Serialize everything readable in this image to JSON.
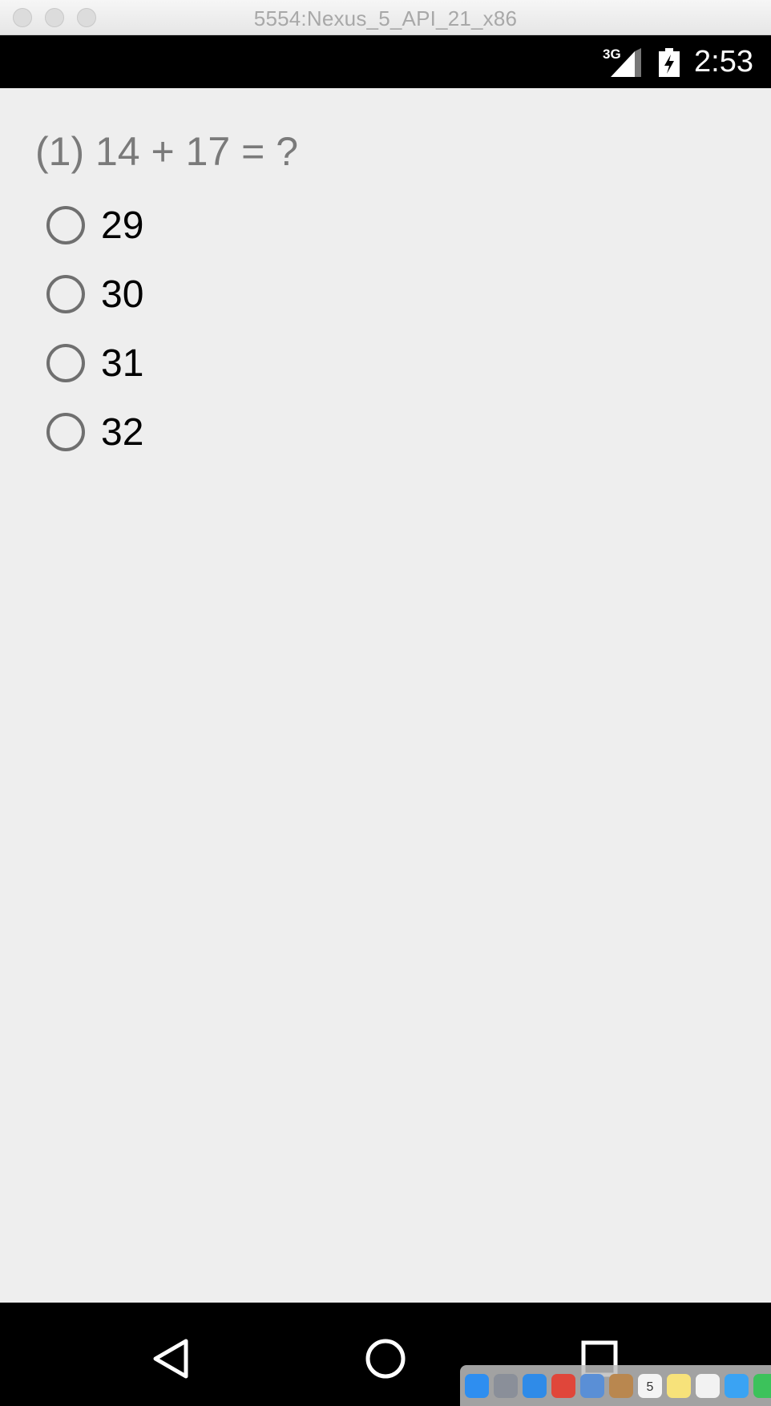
{
  "window": {
    "title": "5554:Nexus_5_API_21_x86"
  },
  "status_bar": {
    "network": "3G",
    "time": "2:53",
    "signal_icon": "cell-signal-icon",
    "battery_icon": "battery-charging-icon"
  },
  "quiz": {
    "question": "(1) 14 + 17 = ?",
    "options": [
      {
        "label": "29",
        "selected": false
      },
      {
        "label": "30",
        "selected": false
      },
      {
        "label": "31",
        "selected": false
      },
      {
        "label": "32",
        "selected": false
      }
    ]
  },
  "nav_bar": {
    "back_icon": "back-triangle-icon",
    "home_icon": "home-circle-icon",
    "recents_icon": "recents-square-icon"
  },
  "dock": {
    "calendar_day": "5",
    "icons": [
      "finder-icon",
      "launchpad-icon",
      "safari-icon",
      "chrome-icon",
      "preview-icon",
      "contacts-icon",
      "calendar-icon",
      "notes-icon",
      "textedit-icon",
      "messages-icon",
      "facetime-icon"
    ],
    "colors": [
      "#2e8ef0",
      "#8a8f99",
      "#2f8be8",
      "#e0463a",
      "#5a8fd6",
      "#b9874f",
      "#f4f4f4",
      "#f7e27a",
      "#f2f2f2",
      "#3aa3f3",
      "#3cc25b"
    ]
  }
}
